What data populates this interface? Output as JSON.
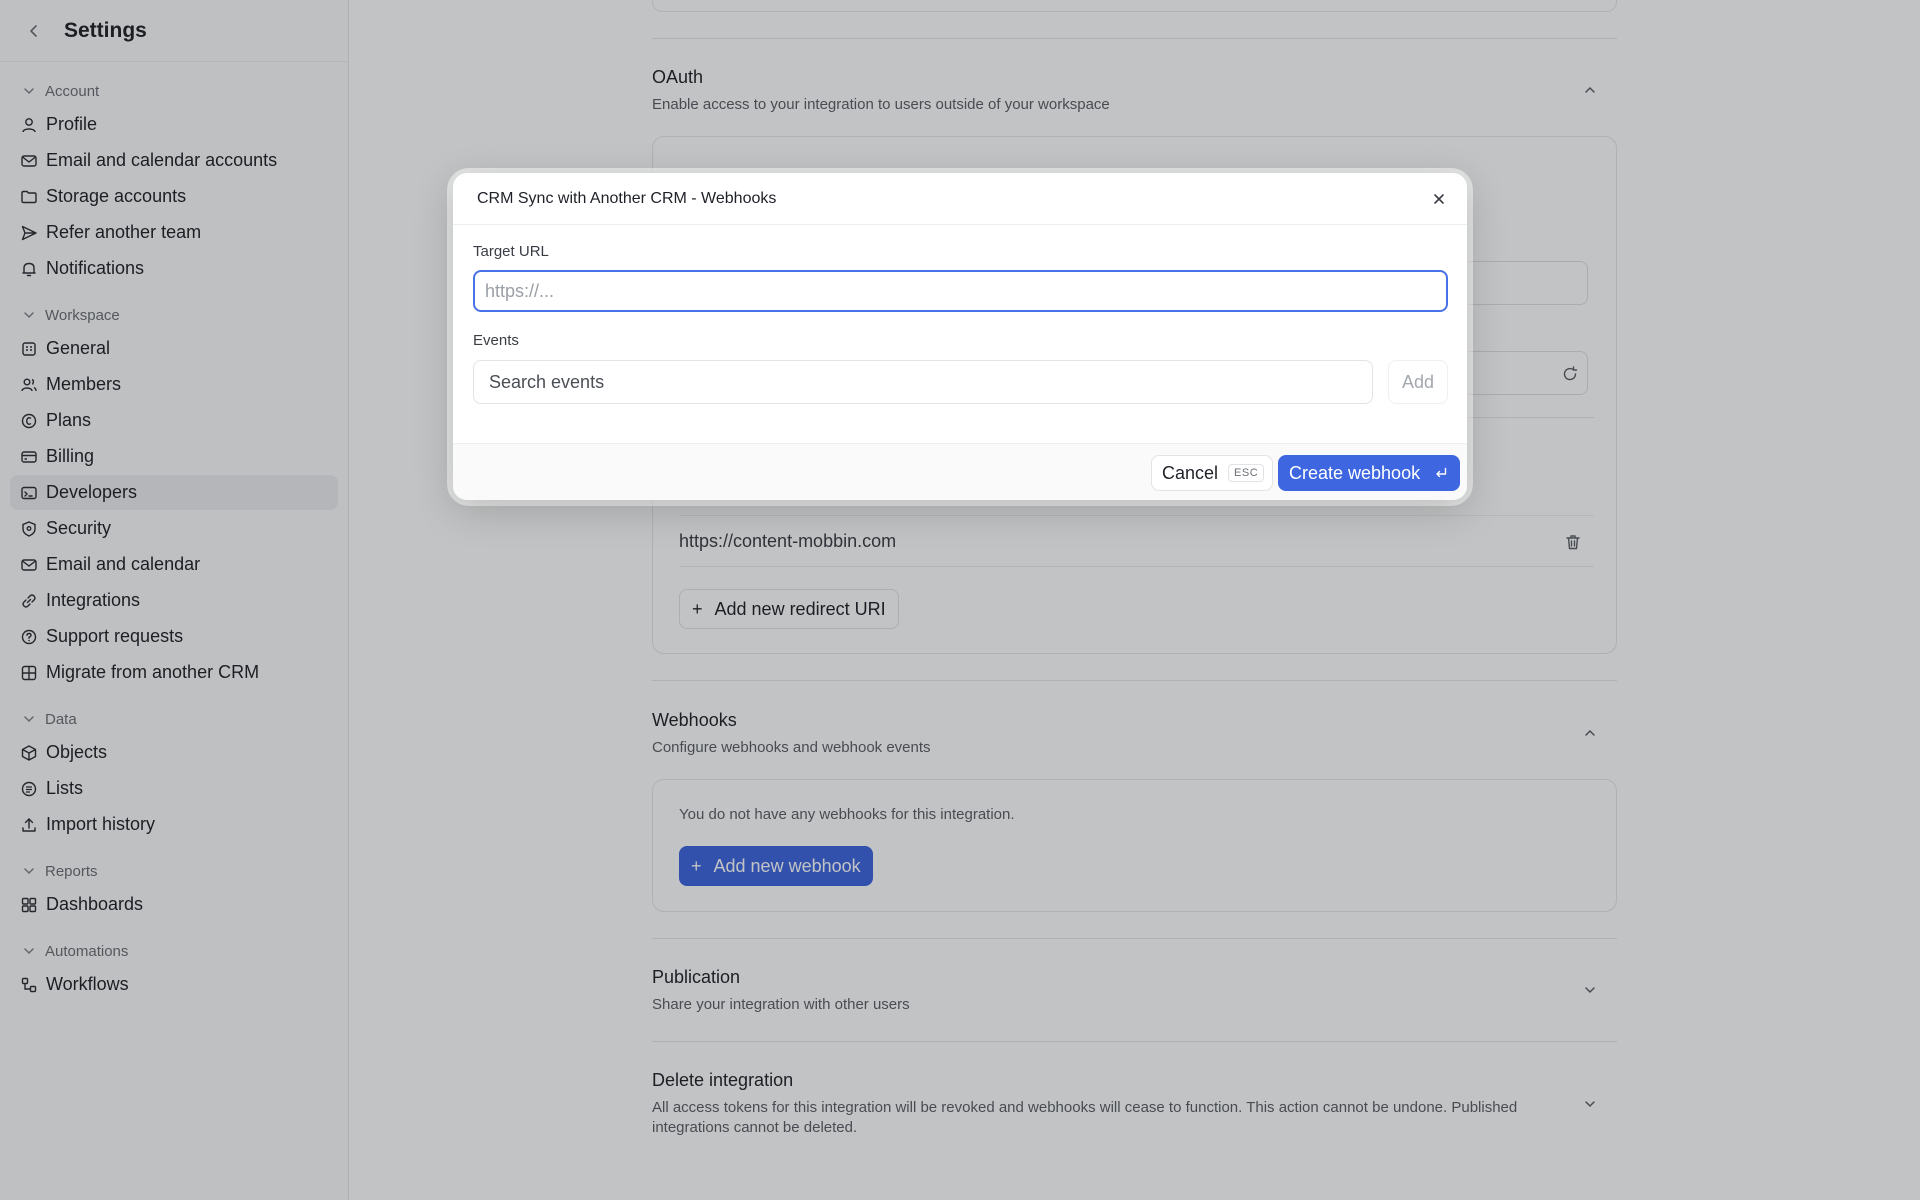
{
  "sidebar": {
    "title": "Settings",
    "sections": [
      {
        "label": "Account",
        "items": [
          {
            "label": "Profile",
            "icon": "user-icon"
          },
          {
            "label": "Email and calendar accounts",
            "icon": "mail-icon"
          },
          {
            "label": "Storage accounts",
            "icon": "folder-icon"
          },
          {
            "label": "Refer another team",
            "icon": "send-icon"
          },
          {
            "label": "Notifications",
            "icon": "bell-icon"
          }
        ]
      },
      {
        "label": "Workspace",
        "items": [
          {
            "label": "General",
            "icon": "building-icon"
          },
          {
            "label": "Members",
            "icon": "users-icon"
          },
          {
            "label": "Plans",
            "icon": "coin-icon"
          },
          {
            "label": "Billing",
            "icon": "card-icon"
          },
          {
            "label": "Developers",
            "icon": "code-icon",
            "active": true
          },
          {
            "label": "Security",
            "icon": "shield-icon"
          },
          {
            "label": "Email and calendar",
            "icon": "mail-icon"
          },
          {
            "label": "Integrations",
            "icon": "link-icon"
          },
          {
            "label": "Support requests",
            "icon": "help-icon"
          },
          {
            "label": "Migrate from another CRM",
            "icon": "grid-icon"
          }
        ]
      },
      {
        "label": "Data",
        "items": [
          {
            "label": "Objects",
            "icon": "cube-icon"
          },
          {
            "label": "Lists",
            "icon": "list-icon"
          },
          {
            "label": "Import history",
            "icon": "upload-icon"
          }
        ]
      },
      {
        "label": "Reports",
        "items": [
          {
            "label": "Dashboards",
            "icon": "dashboard-icon"
          }
        ]
      },
      {
        "label": "Automations",
        "items": [
          {
            "label": "Workflows",
            "icon": "workflow-icon"
          }
        ]
      }
    ]
  },
  "oauth": {
    "title": "OAuth",
    "subtitle": "Enable access to your integration to users outside of your workspace",
    "redirect_uri": "https://content-mobbin.com",
    "add_redirect_label": "Add new redirect URI"
  },
  "webhooks": {
    "title": "Webhooks",
    "subtitle": "Configure webhooks and webhook events",
    "empty_text": "You do not have any webhooks for this integration.",
    "add_label": "Add new webhook"
  },
  "publication": {
    "title": "Publication",
    "subtitle": "Share your integration with other users"
  },
  "delete_integration": {
    "title": "Delete integration",
    "subtitle": "All access tokens for this integration will be revoked and webhooks will cease to function. This action cannot be undone. Published integrations cannot be deleted."
  },
  "modal": {
    "title": "CRM Sync with Another CRM - Webhooks",
    "target_url_label": "Target URL",
    "target_url_placeholder": "https://...",
    "target_url_value": "",
    "events_label": "Events",
    "events_placeholder": "Search events",
    "add_label": "Add",
    "cancel_label": "Cancel",
    "cancel_shortcut": "ESC",
    "create_label": "Create webhook"
  },
  "colors": {
    "accent": "#3d66e0",
    "overlay": "rgba(20,22,28,0.26)"
  }
}
